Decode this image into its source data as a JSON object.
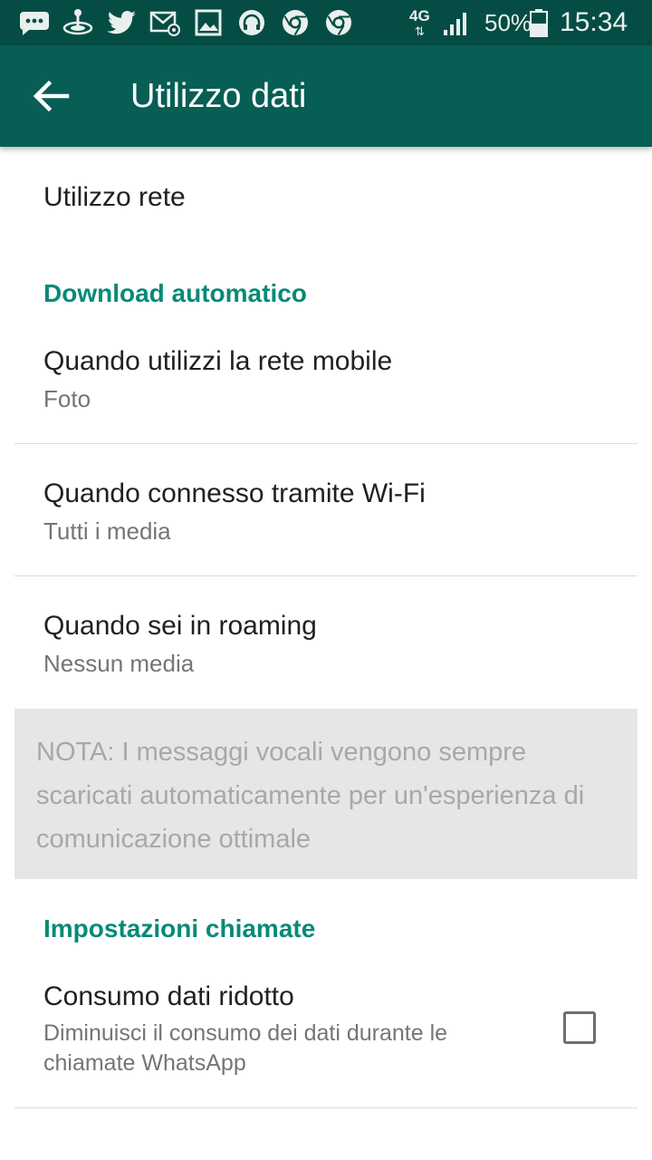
{
  "status_bar": {
    "icons": [
      "chat-bubble-icon",
      "joystick-icon",
      "twitter-icon",
      "mail-icon",
      "image-icon",
      "headphones-icon",
      "chrome-icon",
      "chrome-icon",
      "network-4g-icon",
      "signal-icon",
      "battery-icon"
    ],
    "network_type": "4G",
    "battery": "50%",
    "time": "15:34"
  },
  "app_bar": {
    "title": "Utilizzo dati",
    "back_icon": "arrow-back-icon",
    "background": "#075e54"
  },
  "items": {
    "network_usage": {
      "title": "Utilizzo rete"
    },
    "auto_download_header": "Download automatico",
    "mobile": {
      "title": "Quando utilizzi la rete mobile",
      "value": "Foto"
    },
    "wifi": {
      "title": "Quando connesso tramite Wi-Fi",
      "value": "Tutti i media"
    },
    "roaming": {
      "title": "Quando sei in roaming",
      "value": "Nessun media"
    },
    "note": "NOTA: I messaggi vocali vengono sempre scaricati automaticamente per un'esperienza di comunicazione ottimale",
    "calls_header": "Impostazioni chiamate",
    "low_data": {
      "title": "Consumo dati ridotto",
      "summary": "Diminuisci il consumo dei dati durante le chiamate WhatsApp",
      "checked": false
    }
  },
  "colors": {
    "accent": "#078a78",
    "status_bar": "#054d44"
  }
}
